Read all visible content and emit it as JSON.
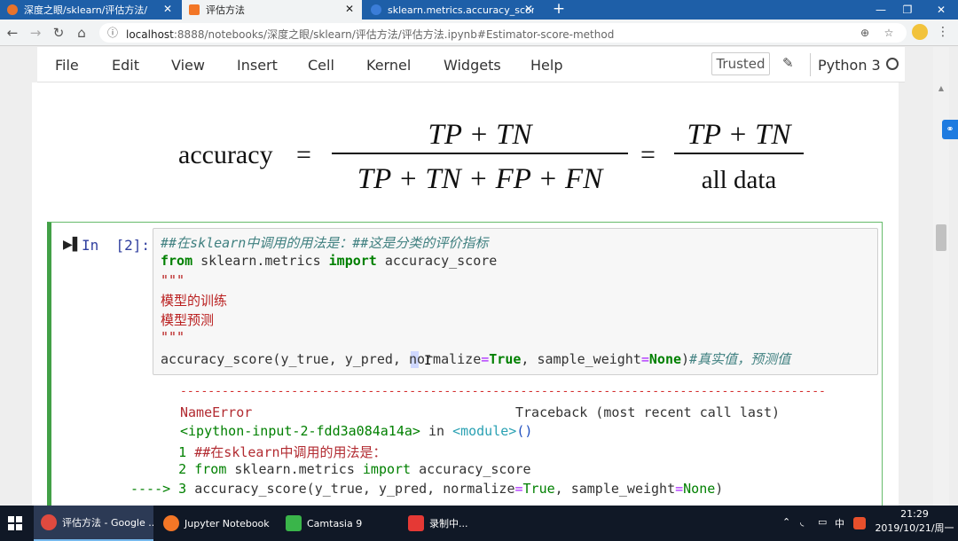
{
  "browser": {
    "tabs": [
      {
        "title": "深度之眼/sklearn/评估方法/",
        "active": false
      },
      {
        "title": "评估方法",
        "active": true
      },
      {
        "title": "sklearn.metrics.accuracy_score",
        "active": false
      }
    ],
    "tab_close": "✕",
    "new_tab": "+",
    "window_controls": {
      "minimize": "—",
      "maximize": "❐",
      "close": "✕"
    },
    "url_host": "localhost",
    "url_rest": ":8888/notebooks/深度之眼/sklearn/评估方法/评估方法.ipynb#Estimator-score-method"
  },
  "jupyter": {
    "menu": [
      "File",
      "Edit",
      "View",
      "Insert",
      "Cell",
      "Kernel",
      "Widgets",
      "Help"
    ],
    "trusted": "Trusted",
    "kernel": "Python 3"
  },
  "formula": {
    "lhs": "accuracy",
    "eq": "=",
    "numerator": "TP + TN",
    "denominator": "TP + TN + FP + FN",
    "numerator2": "TP + TN",
    "denominator2": "all data"
  },
  "cell": {
    "prompt": "In  [2]:",
    "code": {
      "l1_comment": "##在sklearn中调用的用法是：##这是分类的评价指标",
      "l2_from": "from",
      "l2_mod": " sklearn.metrics ",
      "l2_import": "import",
      "l2_name": " accuracy_score",
      "l3": "\"\"\"",
      "l4": "模型的训练",
      "l5": "模型预测",
      "l6": "\"\"\"",
      "l7_a": "accuracy_score(y_true, y_pred, normalize",
      "l7_eq1": "=",
      "l7_true": "True",
      "l7_b": ", sample_weight",
      "l7_eq2": "=",
      "l7_none": "None",
      "l7_c": ")",
      "l7_comment": "#真实值，预测值"
    },
    "output": {
      "dashes": "---------------------------------------------------------------------------------------------",
      "error_name": "NameError",
      "traceback": "Traceback (most recent call last)",
      "input_ref": "<ipython-input-2-fdd3a084a14a>",
      "in": " in ",
      "module": "<module>",
      "parens": "()",
      "t1_num": "      1 ",
      "t1_comment": "##在sklearn中调用的用法是：",
      "t2_num": "      2 ",
      "t2_from": "from",
      "t2_mod": " sklearn.metrics ",
      "t2_import": "import",
      "t2_name": " accuracy_score",
      "t3_arrow": "----> 3 ",
      "t3_a": "accuracy_score(y_true, y_pred, normalize",
      "t3_eq1": "=",
      "t3_true": "True",
      "t3_b": ", sample_weight",
      "t3_eq2": "=",
      "t3_none": "None",
      "t3_c": ")"
    }
  },
  "taskbar": {
    "items": [
      {
        "label": "评估方法 - Google ...",
        "color": "#e04a3f",
        "active": true
      },
      {
        "label": "Jupyter Notebook",
        "color": "#f37626",
        "active": false
      },
      {
        "label": "Camtasia 9",
        "color": "#3ab54a",
        "active": false
      },
      {
        "label": "录制中...",
        "color": "#e53935",
        "active": false
      }
    ],
    "tray_chevron": "⌃",
    "tray_ime": "中",
    "time": "21:29",
    "date": "2019/10/21/周一"
  },
  "colors": {
    "tab_strip": "#1e5fa8",
    "cell_border": "#42a047",
    "prompt": "#303f9f",
    "error": "#b22b31"
  }
}
